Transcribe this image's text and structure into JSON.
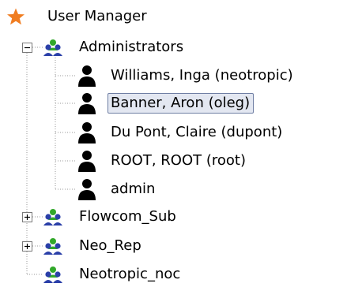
{
  "tree": {
    "root": {
      "label": "User Manager",
      "icon": "star-icon",
      "icon_color": "#f07d21"
    },
    "groups": [
      {
        "label": "Administrators",
        "expanded": true,
        "icon": "group-icon",
        "users": [
          {
            "label": "Williams, Inga  (neotropic)",
            "icon": "user-icon",
            "selected": false
          },
          {
            "label": "Banner, Aron  (oleg)",
            "icon": "user-icon",
            "selected": true
          },
          {
            "label": "Du Pont, Claire  (dupont)",
            "icon": "user-icon",
            "selected": false
          },
          {
            "label": "ROOT, ROOT  (root)",
            "icon": "user-icon",
            "selected": false
          },
          {
            "label": "admin",
            "icon": "user-icon",
            "selected": false
          }
        ]
      },
      {
        "label": "Flowcom_Sub",
        "expanded": false,
        "icon": "group-icon"
      },
      {
        "label": "Neo_Rep",
        "expanded": false,
        "icon": "group-icon"
      },
      {
        "label": "Neotropic_noc",
        "expanded": false,
        "icon": "group-icon",
        "leaf": true
      }
    ]
  },
  "colors": {
    "selection_fill": "#e3e7f1",
    "selection_border": "#6f7ea3",
    "group_green": "#31a82a",
    "group_blue": "#2a3fa8",
    "connector": "#9a9a9a"
  }
}
